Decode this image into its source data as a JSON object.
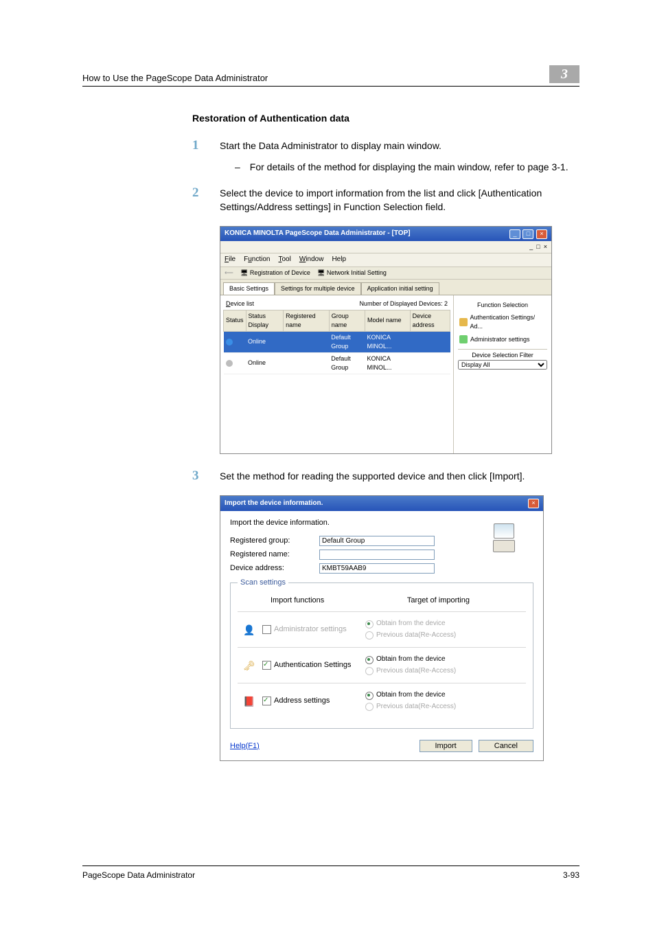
{
  "header": {
    "left": "How to Use the PageScope Data Administrator",
    "chapter": "3"
  },
  "heading": "Restoration of Authentication data",
  "steps": {
    "s1": {
      "num": "1",
      "text": "Start the Data Administrator to display main window.",
      "sub": "For details of the method for displaying the main window, refer to page 3-1."
    },
    "s2": {
      "num": "2",
      "text": "Select the device to import information from the list and click [Authentication Settings/Address settings] in Function Selection field."
    },
    "s3": {
      "num": "3",
      "text": "Set the method for reading the supported device and then click [Import]."
    }
  },
  "app": {
    "title": "KONICA MINOLTA PageScope Data Administrator - [TOP]",
    "menu": {
      "file": "File",
      "function": "Function",
      "tool": "Tool",
      "window": "Window",
      "help": "Help"
    },
    "toolbar": {
      "reg": "Registration of Device",
      "net": "Network Initial Setting"
    },
    "tabs": {
      "basic": "Basic Settings",
      "multi": "Settings for multiple device",
      "appinit": "Application initial setting"
    },
    "deviceListCap": "Device list",
    "countLabel": "Number of Displayed Devices: 2",
    "cols": {
      "status": "Status",
      "statusDisp": "Status Display",
      "regname": "Registered name",
      "group": "Group name",
      "model": "Model name",
      "addr": "Device address"
    },
    "rows": [
      {
        "statusDisp": "Online",
        "group": "Default Group",
        "model": "KONICA MINOL..."
      },
      {
        "statusDisp": "Online",
        "group": "Default Group",
        "model": "KONICA MINOL..."
      }
    ],
    "right": {
      "funcsel": "Function Selection",
      "auth": "Authentication Settings/ Ad...",
      "admin": "Administrator settings",
      "filter": "Device Selection Filter",
      "display": "Display All"
    }
  },
  "dlg": {
    "title": "Import the device information.",
    "caption": "Import the device information.",
    "regGroupLbl": "Registered group:",
    "regGroupVal": "Default Group",
    "regNameLbl": "Registered name:",
    "regNameVal": "",
    "devAddrLbl": "Device address:",
    "devAddrVal": "KMBT59AAB9",
    "scanLegend": "Scan settings",
    "hdrFunc": "Import functions",
    "hdrTarget": "Target of importing",
    "rowAdmin": {
      "label": "Administrator settings",
      "opt1": "Obtain from the device",
      "opt2": "Previous data(Re-Access)"
    },
    "rowAuth": {
      "label": "Authentication Settings",
      "opt1": "Obtain from the device",
      "opt2": "Previous data(Re-Access)"
    },
    "rowAddr": {
      "label": "Address settings",
      "opt1": "Obtain from the device",
      "opt2": "Previous data(Re-Access)"
    },
    "help": "Help(F1)",
    "importBtn": "Import",
    "cancelBtn": "Cancel"
  },
  "footer": {
    "left": "PageScope Data Administrator",
    "right": "3-93"
  }
}
